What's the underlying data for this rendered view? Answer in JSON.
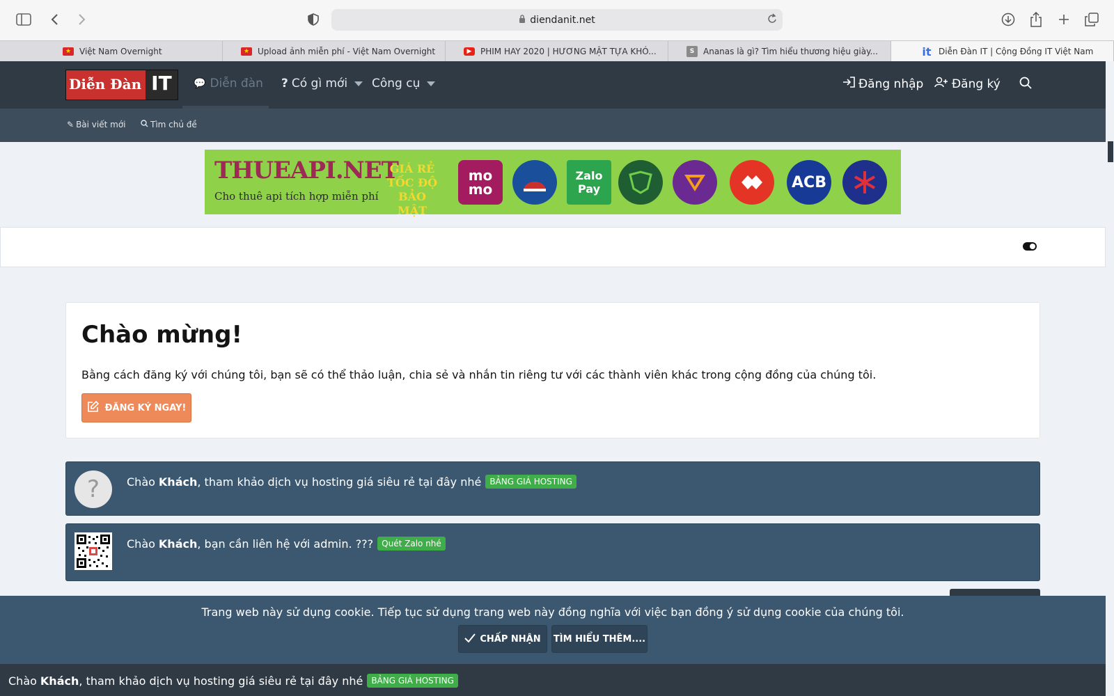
{
  "browser": {
    "url": "diendanit.net",
    "tabs": [
      {
        "title": "Việt Nam Overnight",
        "favicon": "vn-flag-icon"
      },
      {
        "title": "Upload ảnh miễn phí - Việt Nam Overnight",
        "favicon": "vn-flag-icon"
      },
      {
        "title": "PHIM HAY 2020 | HƯƠNG MẬT TỰA KHÓ...",
        "favicon": "youtube-icon"
      },
      {
        "title": "Ananas là gì? Tìm hiểu thương hiệu giày...",
        "favicon": "s-icon"
      },
      {
        "title": "Diễn Đàn IT | Cộng Đồng IT Việt Nam",
        "favicon": "it-icon"
      }
    ]
  },
  "header": {
    "logo_part1": "Diễn Đàn",
    "logo_part2": "IT",
    "nav": {
      "forum": "Diễn đàn",
      "whats_new": "Có gì mới",
      "tools": "Công cụ"
    },
    "login": "Đăng nhập",
    "register": "Đăng ký"
  },
  "subnav": {
    "new_posts": "Bài viết mới",
    "search_threads": "Tìm chủ đề"
  },
  "banner": {
    "brand": "THUEAPI.NET",
    "tagline": "Cho thuê api tích hợp miễn phí",
    "promo_line1": "GIÁ RẺ",
    "promo_line2": "TỐC ĐỘ",
    "promo_line3": "BẢO MẬT",
    "logos": [
      "mo mo",
      "",
      "Zalo Pay",
      "",
      "",
      "",
      "ACB",
      ""
    ]
  },
  "welcome": {
    "title": "Chào mừng!",
    "text": "Bằng cách đăng ký với chúng tôi, bạn sẽ có thể thảo luận, chia sẻ và nhắn tin riêng tư với các thành viên khác trong cộng đồng của chúng tôi.",
    "button": "ĐĂNG KÝ NGAY!"
  },
  "notices": {
    "hosting": {
      "prefix": "Chào",
      "user": "Khách",
      "text": ", tham khảo dịch vụ hosting giá siêu rẻ tại đây nhé",
      "badge": "BẢNG GIÁ HOSTING"
    },
    "contact": {
      "prefix": "Chào",
      "user": "Khách",
      "text": ", bạn cần liên hệ với admin. ???",
      "badge": "Quét Zalo nhé"
    }
  },
  "cookie": {
    "message": "Trang web này sử dụng cookie. Tiếp tục sử dụng trang web này đồng nghĩa với việc bạn đồng ý sử dụng cookie của chúng tôi.",
    "accept": "CHẤP NHẬN",
    "learn_more": "TÌM HIỂU THÊM...."
  },
  "bottom_notice": {
    "prefix": "Chào",
    "user": "Khách",
    "text": ", tham khảo dịch vụ hosting giá siêu rẻ tại đây nhé",
    "badge": "BẢNG GIÁ HOSTING"
  },
  "colors": {
    "header": "#2f3a44",
    "subnav": "#3d4d5c",
    "notice": "#3b5870",
    "badge": "#3fae49",
    "register_button": "#ee8a5a"
  }
}
